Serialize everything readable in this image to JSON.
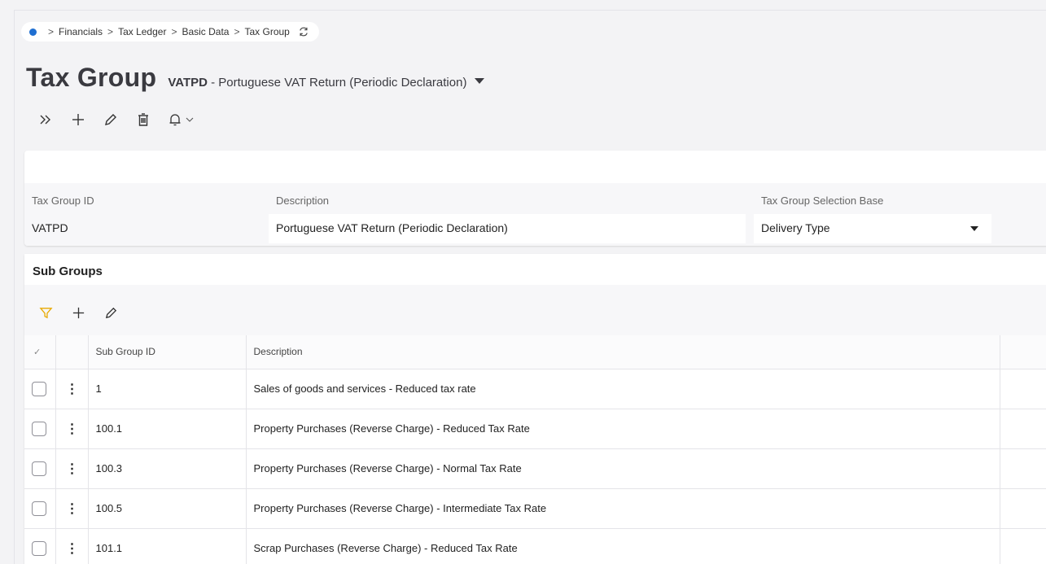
{
  "breadcrumb": {
    "items": [
      "Financials",
      "Tax Ledger",
      "Basic Data",
      "Tax Group"
    ],
    "separator": ">"
  },
  "page": {
    "title": "Tax Group",
    "record_code": "VATPD",
    "record_desc": " - Portuguese VAT Return (Periodic Declaration)"
  },
  "toolbar": {
    "icons": [
      "expand-icon",
      "add-icon",
      "edit-icon",
      "delete-icon",
      "notification-icon"
    ]
  },
  "header": {
    "tax_group_id_label": "Tax Group ID",
    "tax_group_id_value": "VATPD",
    "description_label": "Description",
    "description_value": "Portuguese VAT Return (Periodic Declaration)",
    "selection_base_label": "Tax Group Selection Base",
    "selection_base_value": "Delivery Type"
  },
  "subgroups": {
    "title": "Sub Groups",
    "columns": {
      "id": "Sub Group ID",
      "description": "Description"
    },
    "rows": [
      {
        "id": "1",
        "description": "Sales of goods and services - Reduced tax rate"
      },
      {
        "id": "100.1",
        "description": "Property Purchases (Reverse Charge) - Reduced Tax Rate"
      },
      {
        "id": "100.3",
        "description": "Property Purchases (Reverse Charge) - Normal Tax Rate"
      },
      {
        "id": "100.5",
        "description": "Property Purchases (Reverse Charge) - Intermediate Tax Rate"
      },
      {
        "id": "101.1",
        "description": "Scrap Purchases (Reverse Charge) - Reduced Tax Rate"
      }
    ]
  },
  "colors": {
    "accent": "#1f6fd1",
    "filter": "#e8a900",
    "background": "#f3f3f5"
  }
}
